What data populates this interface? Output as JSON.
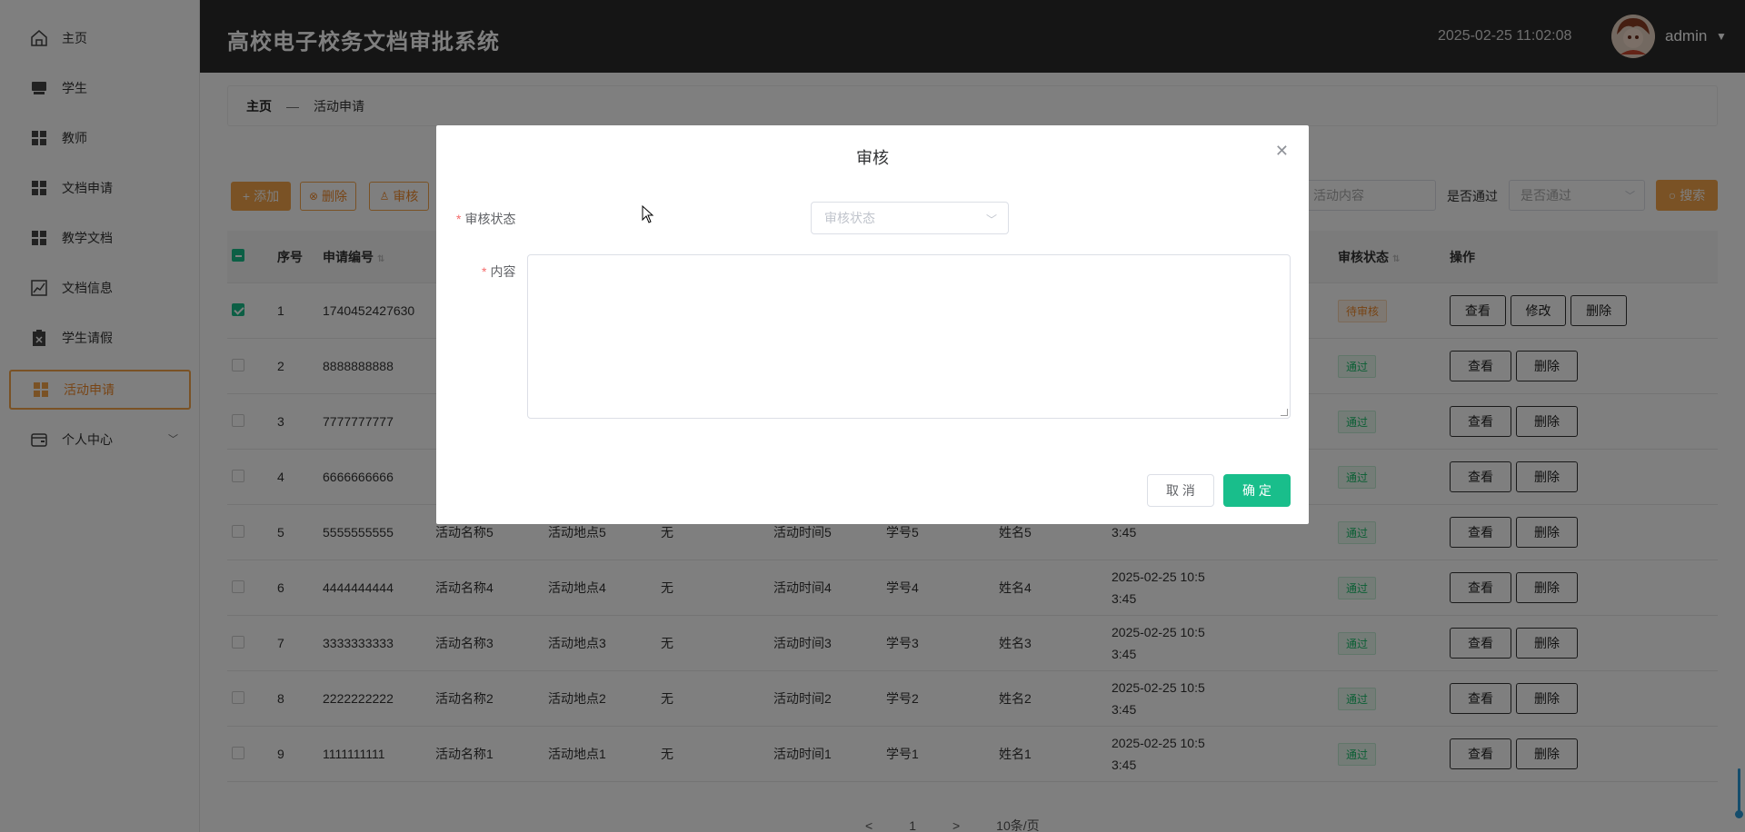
{
  "sidebar": {
    "items": [
      {
        "label": "主页",
        "icon": "home-icon"
      },
      {
        "label": "学生",
        "icon": "inbox-icon"
      },
      {
        "label": "教师",
        "icon": "grid-icon"
      },
      {
        "label": "文档申请",
        "icon": "grid-icon"
      },
      {
        "label": "教学文档",
        "icon": "grid-icon"
      },
      {
        "label": "文档信息",
        "icon": "chart-icon"
      },
      {
        "label": "学生请假",
        "icon": "clipboard-icon"
      },
      {
        "label": "活动申请",
        "icon": "grid-icon",
        "active": true
      },
      {
        "label": "个人中心",
        "icon": "wallet-icon"
      }
    ]
  },
  "header": {
    "title": "高校电子校务文档审批系统",
    "datetime": "2025-02-25 11:02:08",
    "username": "admin"
  },
  "breadcrumb": {
    "home": "主页",
    "sep": "—",
    "current": "活动申请"
  },
  "toolbar": {
    "add": "添加",
    "delete": "删除",
    "audit": "审核",
    "content_placeholder": "活动内容",
    "pass_label": "是否通过",
    "pass_placeholder": "是否通过",
    "search": "搜索"
  },
  "table": {
    "headers": {
      "index": "序号",
      "apply_no": "申请编号",
      "status": "审核状态",
      "ops": "操作"
    },
    "rows": [
      {
        "idx": "1",
        "no": "1740452427630",
        "name": "",
        "place": "",
        "content": "",
        "time": "",
        "sid": "",
        "sname": "",
        "date1": "",
        "date2": "",
        "status": "待审核",
        "checked": true
      },
      {
        "idx": "2",
        "no": "8888888888",
        "name": "",
        "place": "",
        "content": "",
        "time": "",
        "sid": "",
        "sname": "",
        "date1": "",
        "date2": "",
        "status": "通过"
      },
      {
        "idx": "3",
        "no": "7777777777",
        "name": "",
        "place": "",
        "content": "",
        "time": "",
        "sid": "",
        "sname": "",
        "date1": "",
        "date2": "",
        "status": "通过"
      },
      {
        "idx": "4",
        "no": "6666666666",
        "name": "",
        "place": "",
        "content": "",
        "time": "",
        "sid": "",
        "sname": "",
        "date1": "",
        "date2": "",
        "status": "通过"
      },
      {
        "idx": "5",
        "no": "5555555555",
        "name": "活动名称5",
        "place": "活动地点5",
        "content": "无",
        "time": "活动时间5",
        "sid": "学号5",
        "sname": "姓名5",
        "date1": "",
        "date2": "3:45",
        "status": "通过"
      },
      {
        "idx": "6",
        "no": "4444444444",
        "name": "活动名称4",
        "place": "活动地点4",
        "content": "无",
        "time": "活动时间4",
        "sid": "学号4",
        "sname": "姓名4",
        "date1": "2025-02-25 10:5",
        "date2": "3:45",
        "status": "通过"
      },
      {
        "idx": "7",
        "no": "3333333333",
        "name": "活动名称3",
        "place": "活动地点3",
        "content": "无",
        "time": "活动时间3",
        "sid": "学号3",
        "sname": "姓名3",
        "date1": "2025-02-25 10:5",
        "date2": "3:45",
        "status": "通过"
      },
      {
        "idx": "8",
        "no": "2222222222",
        "name": "活动名称2",
        "place": "活动地点2",
        "content": "无",
        "time": "活动时间2",
        "sid": "学号2",
        "sname": "姓名2",
        "date1": "2025-02-25 10:5",
        "date2": "3:45",
        "status": "通过"
      },
      {
        "idx": "9",
        "no": "1111111111",
        "name": "活动名称1",
        "place": "活动地点1",
        "content": "无",
        "time": "活动时间1",
        "sid": "学号1",
        "sname": "姓名1",
        "date1": "2025-02-25 10:5",
        "date2": "3:45",
        "status": "通过"
      }
    ],
    "btn_view": "查看",
    "btn_edit": "修改",
    "btn_delete": "删除"
  },
  "pagination": {
    "prev": "<",
    "page": "1",
    "next": ">",
    "page_size": "10条/页"
  },
  "modal": {
    "title": "审核",
    "status_label": "审核状态",
    "status_placeholder": "审核状态",
    "content_label": "内容",
    "cancel": "取 消",
    "ok": "确 定"
  },
  "colors": {
    "accent": "#f5a54a",
    "primary": "#19be8b",
    "header_bg": "#2b2b2b"
  }
}
